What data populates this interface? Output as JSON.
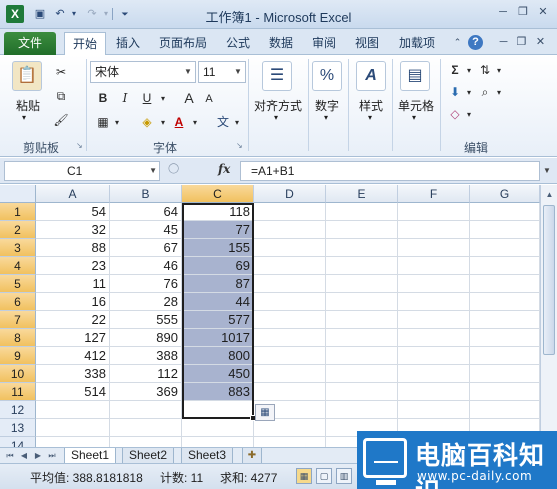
{
  "window": {
    "title": "工作簿1 - Microsoft Excel",
    "app_icon": "X"
  },
  "quick_access": [
    {
      "name": "save-icon",
      "glyph": "💾"
    },
    {
      "name": "undo-icon",
      "glyph": "↶"
    },
    {
      "name": "undo-dropdown-icon",
      "glyph": "▾"
    },
    {
      "name": "redo-icon",
      "glyph": "↷"
    },
    {
      "name": "redo-dropdown-icon",
      "glyph": "▾"
    },
    {
      "name": "customize-qat-icon",
      "glyph": "⏷"
    }
  ],
  "window_buttons": {
    "minimize": "─",
    "restore": "❐",
    "close": "✕"
  },
  "tabs": {
    "file": "文件",
    "home": "开始",
    "insert": "插入",
    "page_layout": "页面布局",
    "formulas": "公式",
    "data": "数据",
    "review": "审阅",
    "view": "视图",
    "addins": "加载项"
  },
  "ribbon": {
    "clipboard": {
      "paste_label": "粘贴",
      "group_label": "剪贴板"
    },
    "font": {
      "group_label": "字体",
      "font_name": "宋体",
      "font_size": "11",
      "bold": "B",
      "italic": "I",
      "underline": "U",
      "grow": "A",
      "shrink": "A",
      "font_color_letter": "A",
      "phonetic_letter": "文"
    },
    "alignment": {
      "label": "对齐方式"
    },
    "number": {
      "label": "数字",
      "glyph": "%"
    },
    "styles": {
      "label": "样式",
      "glyph": "A"
    },
    "cells": {
      "label": "单元格"
    },
    "editing": {
      "group_label": "编辑",
      "sum_glyph": "Σ"
    }
  },
  "formula_bar": {
    "name_box": "C1",
    "fx": "fx",
    "formula": "=A1+B1"
  },
  "grid": {
    "columns": [
      "A",
      "B",
      "C",
      "D",
      "E",
      "F",
      "G"
    ],
    "selected_column": "C",
    "rows": [
      "1",
      "2",
      "3",
      "4",
      "5",
      "6",
      "7",
      "8",
      "9",
      "10",
      "11",
      "12",
      "13",
      "14"
    ],
    "data": [
      [
        "54",
        "64",
        "118"
      ],
      [
        "32",
        "45",
        "77"
      ],
      [
        "88",
        "67",
        "155"
      ],
      [
        "23",
        "46",
        "69"
      ],
      [
        "11",
        "76",
        "87"
      ],
      [
        "16",
        "28",
        "44"
      ],
      [
        "22",
        "555",
        "577"
      ],
      [
        "127",
        "890",
        "1017"
      ],
      [
        "412",
        "388",
        "800"
      ],
      [
        "338",
        "112",
        "450"
      ],
      [
        "514",
        "369",
        "883"
      ]
    ]
  },
  "sheets": [
    "Sheet1",
    "Sheet2",
    "Sheet3"
  ],
  "active_sheet": "Sheet1",
  "status": {
    "average": "平均值: 388.8181818",
    "count": "计数: 11",
    "sum": "求和: 4277"
  },
  "watermark": {
    "title": "电脑百科知识",
    "url": "www.pc-daily.com"
  }
}
